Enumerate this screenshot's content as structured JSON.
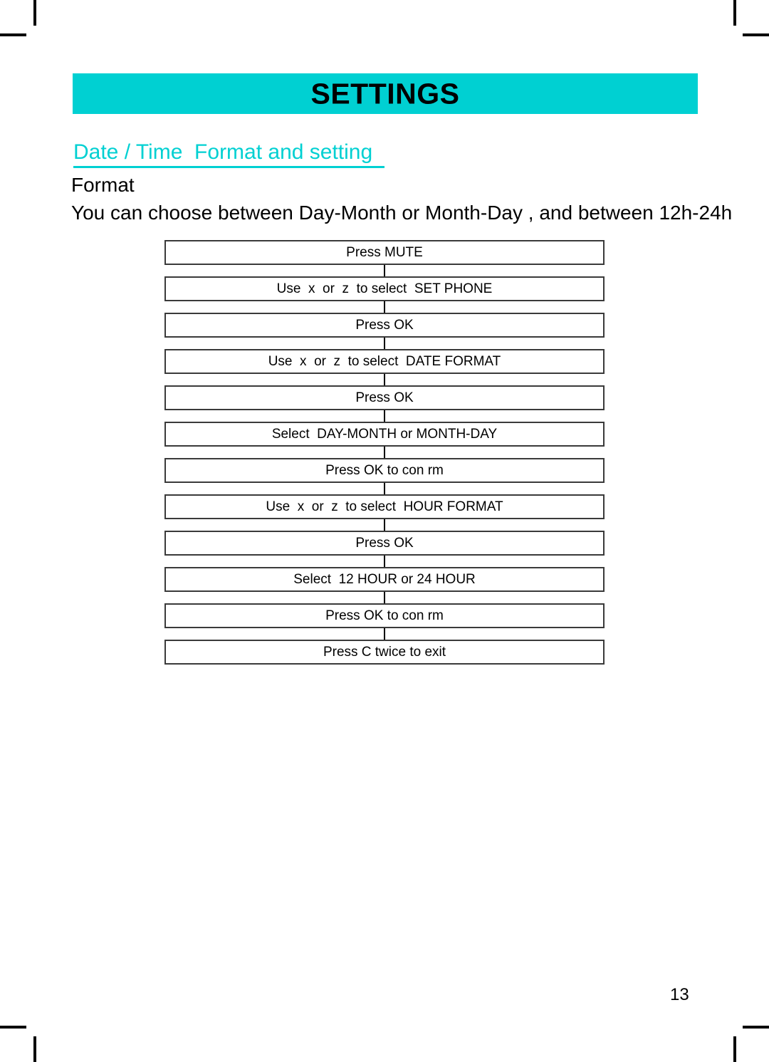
{
  "banner": {
    "title": "SETTINGS",
    "background_color": "#00d0d2"
  },
  "section": {
    "heading": "Date / Time  Format and setting  ",
    "heading_color": "#00d0d2",
    "subheading": "Format",
    "description": "You can choose between Day-Month or Month-Day , and between 12h-24h"
  },
  "flowchart": {
    "steps": [
      {
        "label": "Press MUTE"
      },
      {
        "label": "Use  x  or  z  to select  SET PHONE"
      },
      {
        "label": "Press OK"
      },
      {
        "label": "Use  x  or  z  to select  DATE FORMAT"
      },
      {
        "label": "Press OK"
      },
      {
        "label": "Select  DAY-MONTH or MONTH-DAY"
      },
      {
        "label": "Press OK to con rm"
      },
      {
        "label": "Use  x  or  z  to select  HOUR FORMAT"
      },
      {
        "label": "Press OK"
      },
      {
        "label": "Select  12 HOUR or 24 HOUR"
      },
      {
        "label": "Press OK to con rm"
      },
      {
        "label": "Press C twice to exit"
      }
    ]
  },
  "footer": {
    "page_number": "13"
  }
}
